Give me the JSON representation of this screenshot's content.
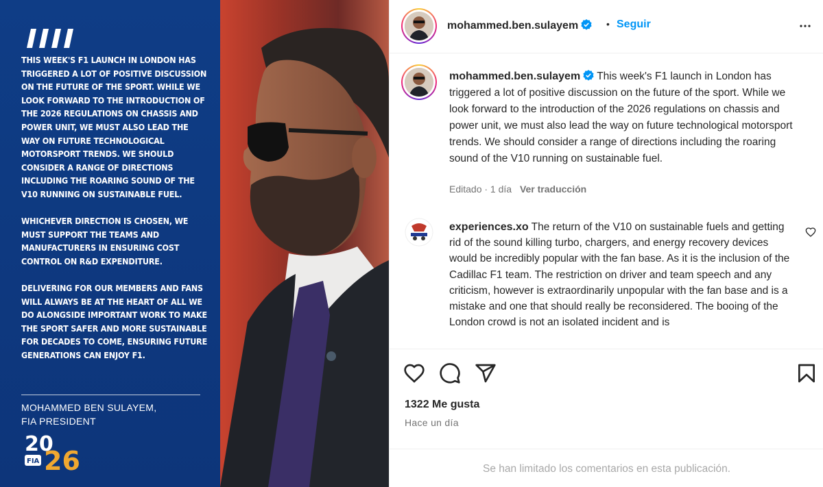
{
  "image": {
    "statement_paragraphs": [
      "This week's F1 launch in London has triggered a lot of positive discussion on the future of the sport. While we look forward to the introduction of the 2026 regulations on chassis and power unit, we must also lead the way on future technological motorsport trends. We should consider a range of directions including the roaring sound of the V10 running on sustainable fuel.",
      "Whichever direction is chosen, we must support the teams and manufacturers in ensuring cost control on R&D expenditure.",
      "Delivering for our members and fans will always be at the heart of all we do alongside important work to make the sport safer and more sustainable for decades to come, ensuring future generations can enjoy F1."
    ],
    "signature_name": "MOHAMMED BEN SULAYEM,",
    "signature_role": "FIA PRESIDENT",
    "logo_year_top": "20",
    "logo_year_bottom": "26",
    "logo_fia": "FIA"
  },
  "header": {
    "username": "mohammed.ben.sulayem",
    "dot": "•",
    "follow_label": "Seguir"
  },
  "caption": {
    "username": "mohammed.ben.sulayem",
    "text": "This week's F1 launch in London has triggered a lot of positive discussion on the future of the sport. While we look forward to the introduction of the 2026 regulations on chassis and power unit, we must also lead the way on future technological motorsport trends. We should consider a range of directions including the roaring sound of the V10 running on sustainable fuel.",
    "meta": "Editado · 1 día",
    "translate_label": "Ver traducción"
  },
  "comment": {
    "username": "experiences.xo",
    "text": "The return of the V10 on sustainable fuels and getting rid of the sound killing turbo, chargers, and energy recovery devices would be incredibly popular with the fan base. As it is the inclusion of the Cadillac F1 team. The restriction on driver and team speech and any criticism, however is extraordinarily unpopular with the fan base and is a mistake and one that should really be reconsidered. The booing of the London crowd is not an isolated incident and is"
  },
  "actions": {
    "likes": "1322 Me gusta",
    "time_ago": "Hace un día",
    "comments_limited": "Se han limitado los comentarios en esta publicación."
  },
  "colors": {
    "link_blue": "#0095f6",
    "panel_blue": "#0f3a82",
    "muted_text": "#737373",
    "verified_blue": "#0095f6"
  },
  "icons": [
    "slashes-icon",
    "verified-icon",
    "more-icon",
    "heart-icon",
    "comment-icon",
    "share-icon",
    "bookmark-icon"
  ]
}
